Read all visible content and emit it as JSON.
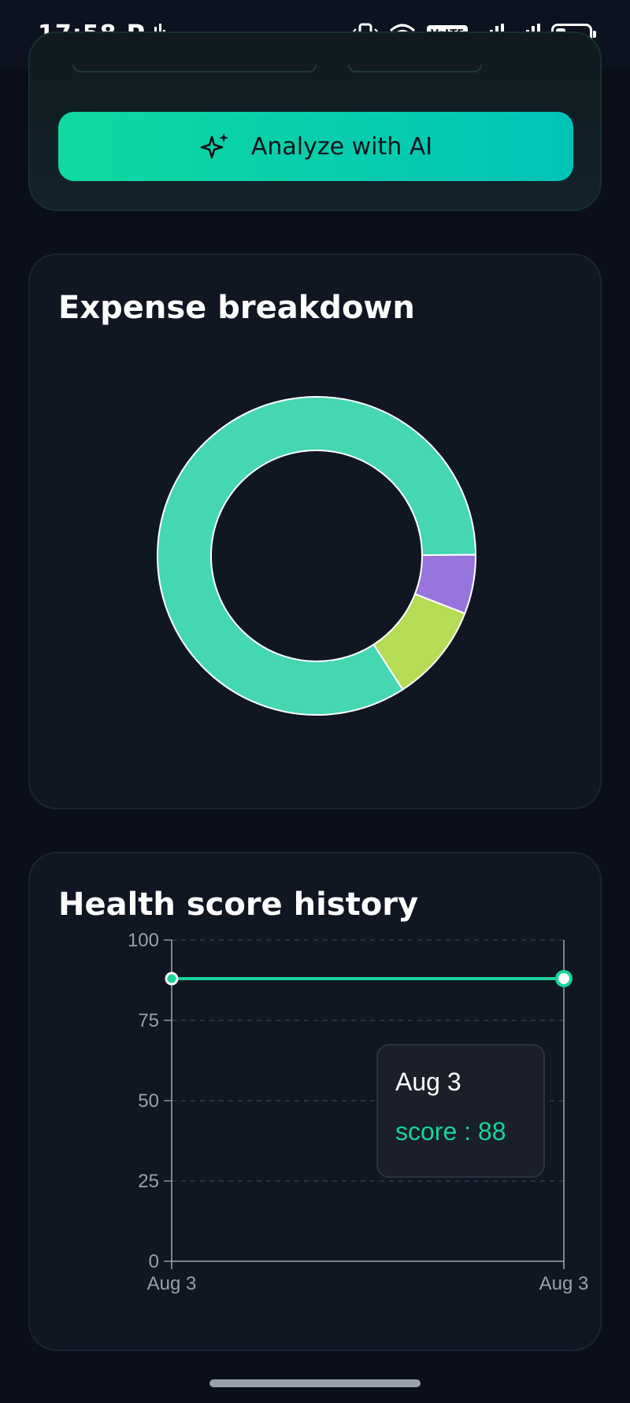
{
  "status_bar": {
    "time": "17:58",
    "carrier_icon": "P",
    "volte": "VoLTE",
    "icons": [
      "vibrate-icon",
      "wifi-icon",
      "signal-icon",
      "signal-icon",
      "battery-icon"
    ]
  },
  "ai_button": {
    "label": "Analyze with AI",
    "icon": "sparkle-icon",
    "color_from": "#10d9a0",
    "color_to": "#00c4b8"
  },
  "expense_card": {
    "title": "Expense breakdown",
    "chart_data": {
      "type": "pie",
      "slices": [
        {
          "value": 84,
          "color": "#44d7b2"
        },
        {
          "value": 10,
          "color": "#b5dc55"
        },
        {
          "value": 6,
          "color": "#9775dc"
        }
      ]
    }
  },
  "health_card": {
    "title": "Health score history",
    "chart_data": {
      "type": "line",
      "x": [
        "Aug 3",
        "Aug 3"
      ],
      "series": [
        {
          "values": [
            88,
            88
          ],
          "color": "#17d49b"
        }
      ],
      "ylim": [
        0,
        100
      ],
      "yticks": [
        "0",
        "25",
        "50",
        "75",
        "100"
      ],
      "grid": true
    },
    "tooltip": {
      "date": "Aug 3",
      "value": "score : 88"
    }
  }
}
